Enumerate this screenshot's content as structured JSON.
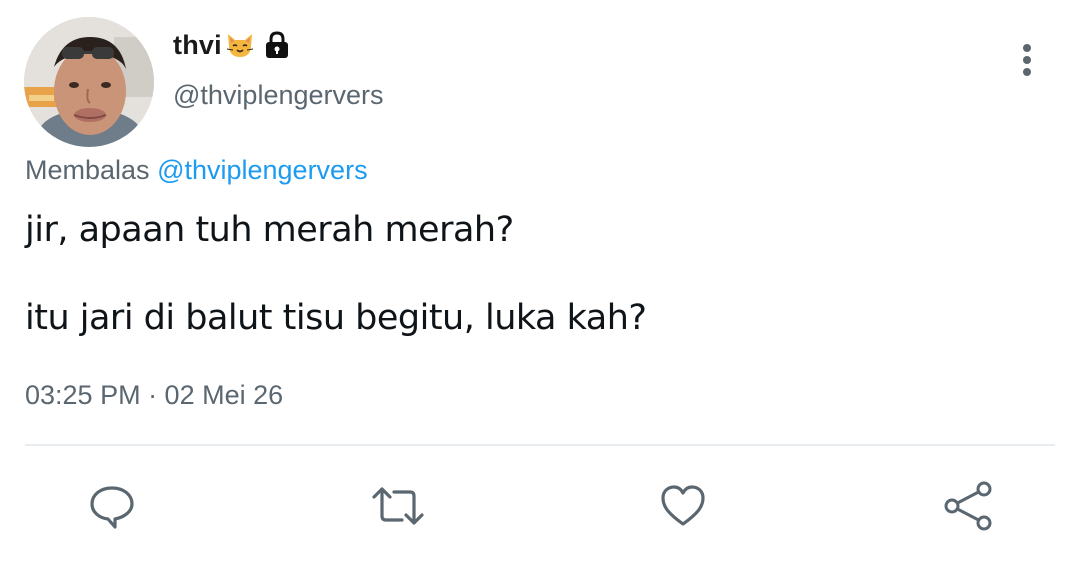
{
  "tweet": {
    "display_name": "thvi",
    "display_name_emoji_icon": "cat-face-icon",
    "protected_icon": "lock-icon",
    "handle": "@thviplengervers",
    "reply_prefix": "Membalas",
    "reply_to": "@thviplengervers",
    "body_line_1": "jir, apaan tuh merah merah?",
    "body_line_2": "itu jari di balut tisu begitu, luka kah?",
    "timestamp": "03:25 PM · 02 Mei 26"
  },
  "actions": [
    {
      "name": "reply",
      "icon": "comment-icon"
    },
    {
      "name": "retweet",
      "icon": "retweet-icon"
    },
    {
      "name": "like",
      "icon": "heart-icon"
    },
    {
      "name": "share",
      "icon": "share-icon"
    }
  ],
  "colors": {
    "text_primary": "#0f1419",
    "text_secondary": "#5b6770",
    "link": "#1d9bf0",
    "divider": "#e6ecf0"
  }
}
